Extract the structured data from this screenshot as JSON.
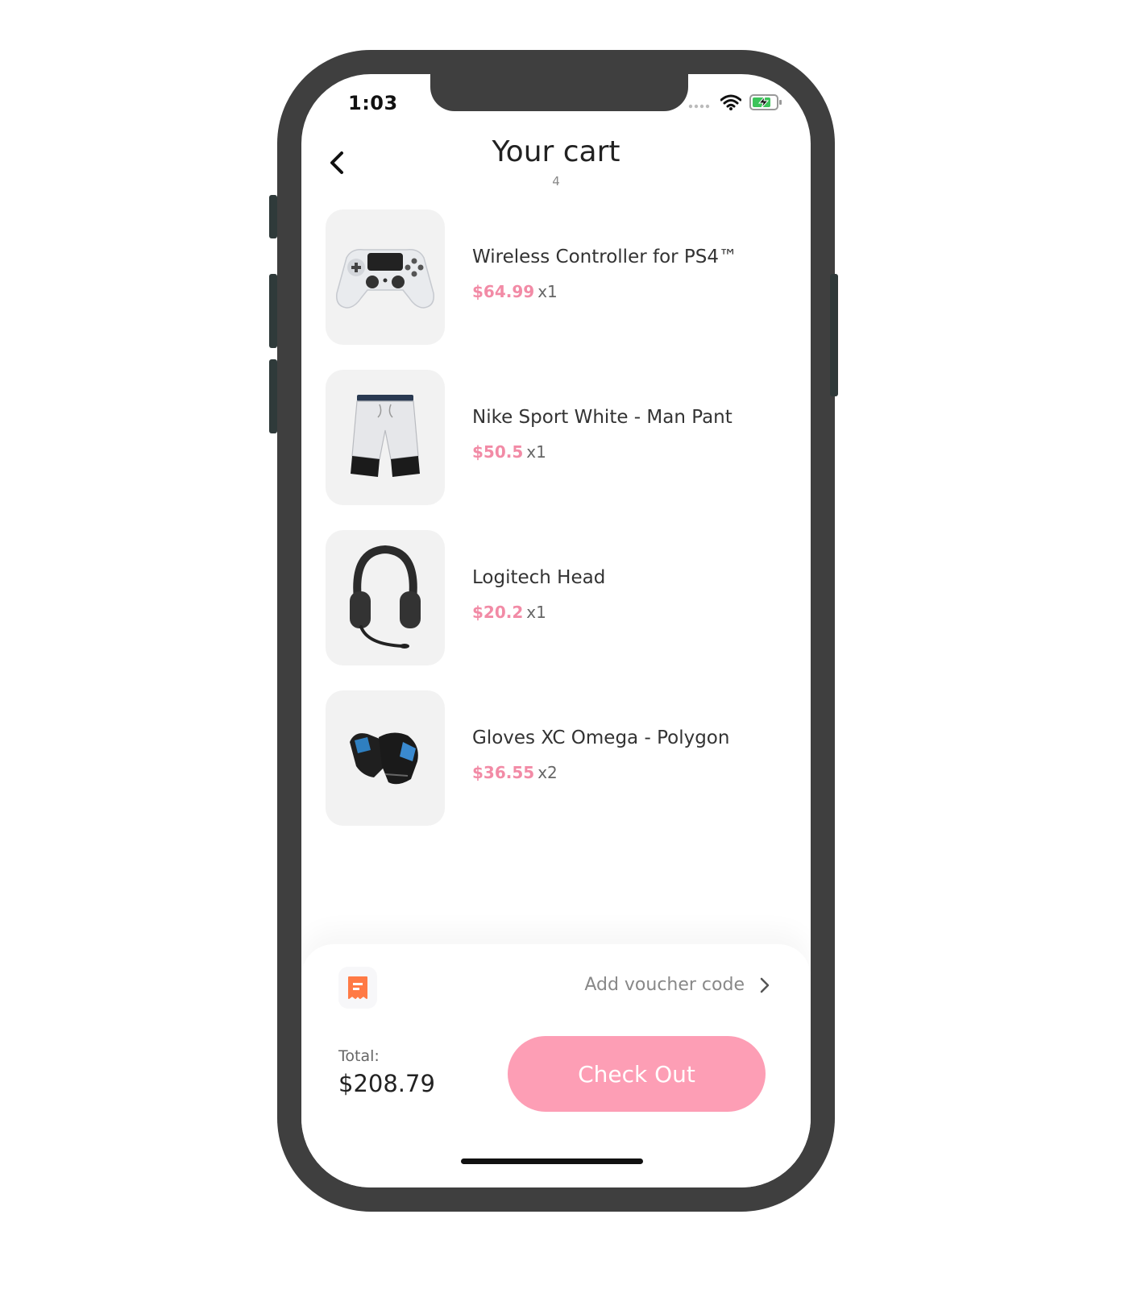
{
  "status_bar": {
    "time": "1:03",
    "icons": [
      "cellular-icon",
      "wifi-icon",
      "battery-charging-icon"
    ],
    "battery_color": "#3cc45a"
  },
  "header": {
    "title": "Your cart",
    "item_count": "4",
    "back_icon": "chevron-left-icon"
  },
  "cart": {
    "items": [
      {
        "name": "Wireless Controller for PS4™",
        "price": "$64.99",
        "qty": "x1",
        "image": "gamepad-image"
      },
      {
        "name": "Nike Sport White - Man Pant",
        "price": "$50.5",
        "qty": "x1",
        "image": "shorts-image"
      },
      {
        "name": "Logitech Head",
        "price": "$20.2",
        "qty": "x1",
        "image": "headset-image"
      },
      {
        "name": "Gloves XC Omega - Polygon",
        "price": "$36.55",
        "qty": "x2",
        "image": "gloves-image"
      }
    ]
  },
  "footer": {
    "voucher_label": "Add voucher code",
    "voucher_icon": "receipt-icon",
    "total_label": "Total:",
    "total_value": "$208.79",
    "checkout_label": "Check Out"
  },
  "colors": {
    "accent": "#fd9eb5",
    "price": "#f28ba6",
    "voucher_icon": "#ff7a45"
  }
}
